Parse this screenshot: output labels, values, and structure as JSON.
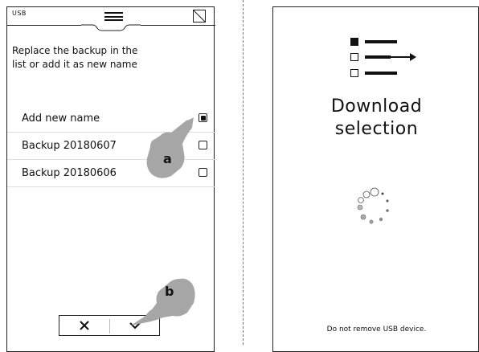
{
  "left_screen": {
    "usb_label": "USB",
    "instruction_line1": "Replace the backup in the",
    "instruction_line2": "list or add it as new name",
    "items": [
      {
        "label": "Add new name",
        "checked": true
      },
      {
        "label": "Backup 20180607",
        "checked": false
      },
      {
        "label": "Backup 20180606",
        "checked": false
      }
    ],
    "cancel_icon": "x-icon",
    "confirm_icon": "chevron-down-icon"
  },
  "annotations": {
    "a": "a",
    "b": "b"
  },
  "right_screen": {
    "title_line1": "Download",
    "title_line2": "selection",
    "footer": "Do not remove USB device.",
    "icon": "download-selection-icon",
    "spinner": "loading-spinner"
  }
}
